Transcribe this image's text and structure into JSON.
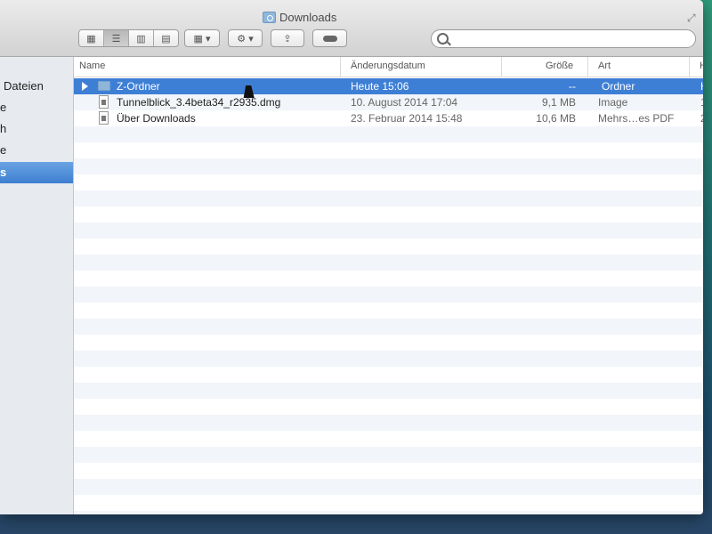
{
  "window": {
    "title": "Downloads"
  },
  "toolbar": {
    "view_buttons": [
      "icon-view",
      "list-view",
      "column-view",
      "coverflow-view"
    ],
    "arrange_label": "▾",
    "action_label": "▾"
  },
  "search": {
    "value": "",
    "placeholder": ""
  },
  "sidebar": {
    "items": [
      {
        "label": "Dateien",
        "selected": false
      },
      {
        "label": "e",
        "selected": false
      },
      {
        "label": "h",
        "selected": false
      },
      {
        "label": "e",
        "selected": false
      },
      {
        "label": "s",
        "selected": true
      }
    ]
  },
  "columns": {
    "name": "Name",
    "date": "Änderungsdatum",
    "size": "Größe",
    "kind": "Art",
    "extra": "H"
  },
  "files": [
    {
      "name": "Z-Ordner",
      "date": "Heute 15:06",
      "size": "--",
      "kind": "Ordner",
      "extra": "H",
      "type": "folder",
      "selected": true
    },
    {
      "name": "Tunnelblick_3.4beta34_r2935.dmg",
      "date": "10. August 2014 17:04",
      "size": "9,1 MB",
      "kind": "Image",
      "extra": "1",
      "type": "file",
      "selected": false
    },
    {
      "name": "Über Downloads",
      "date": "23. Februar 2014 15:48",
      "size": "10,6 MB",
      "kind": "Mehrs…es PDF",
      "extra": "2",
      "type": "file",
      "selected": false
    }
  ],
  "colors": {
    "selection": "#3e7fd6",
    "sidebar_selection": "#4a8ad8"
  }
}
